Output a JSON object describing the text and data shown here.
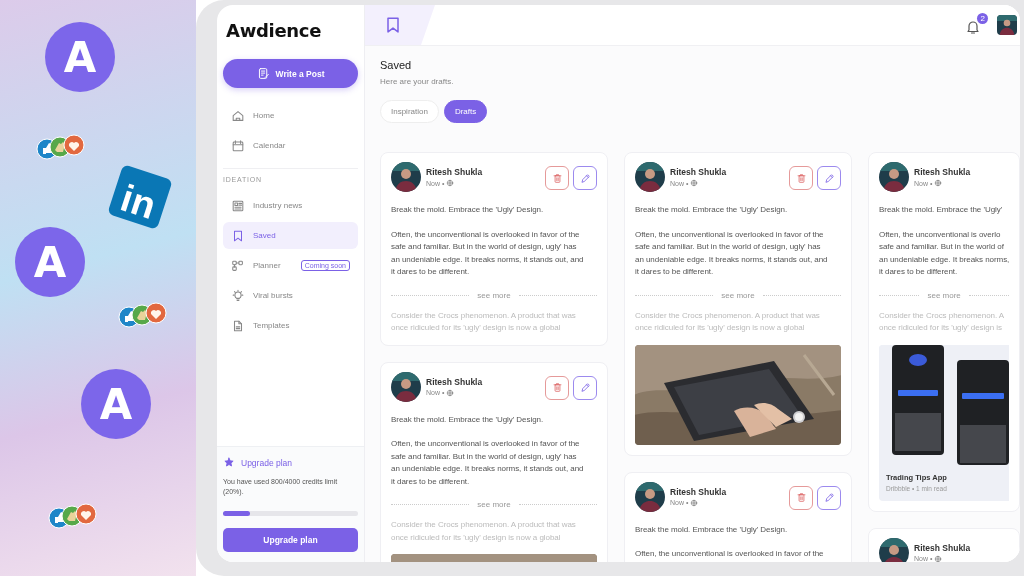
{
  "decorations": [
    {
      "kind": "logo",
      "text": "A"
    },
    {
      "kind": "reactions"
    },
    {
      "kind": "social",
      "text": "in"
    },
    {
      "kind": "logo",
      "text": "A"
    },
    {
      "kind": "reactions"
    },
    {
      "kind": "logo",
      "text": "A"
    },
    {
      "kind": "reactions"
    }
  ],
  "sidebar": {
    "logo": "Awdience",
    "write_button": "Write a Post",
    "nav": [
      {
        "label": "Home",
        "selected": false
      },
      {
        "label": "Calendar",
        "selected": false
      }
    ],
    "section": "IDEATION",
    "items": [
      {
        "label": "Industry news",
        "selected": false
      },
      {
        "label": "Saved",
        "selected": true
      },
      {
        "label": "Planner",
        "selected": false,
        "badge": "Coming soon"
      },
      {
        "label": "Viral bursts",
        "selected": false
      },
      {
        "label": "Templates",
        "selected": false
      }
    ],
    "upgrade": {
      "title": "Upgrade plan",
      "text": "You have used 800/4000 credits limit (20%).",
      "level": 0.2,
      "button": "Upgrade plan"
    }
  },
  "header": {
    "notifications": "2"
  },
  "page": {
    "title": "Saved",
    "subtitle": "Here are your drafts.",
    "tabs": [
      {
        "label": "Inspiration",
        "selected": false
      },
      {
        "label": "Drafts",
        "selected": true
      }
    ]
  },
  "columns": [
    [
      {
        "author": "Ritesh Shukla",
        "time": "Now •",
        "actions": true,
        "paragraphs": [
          [
            "Break the mold. Embrace the 'Ugly' Design."
          ],
          [
            "Often, the unconventional is overlooked in favor of the",
            "safe and familiar. But in the world of design, ugly' has",
            "an undeniable edge. It breaks norms, it stands out, and",
            "it dares to be different."
          ]
        ],
        "see_more": "see more",
        "excerpt": [
          "Consider the Crocs phenomenon. A product that was",
          "once ridiculed for its 'ugly' design is now a global"
        ]
      },
      {
        "author": "Ritesh Shukla",
        "time": "Now •",
        "actions": true,
        "paragraphs": [
          [
            "Break the mold. Embrace the 'Ugly' Design."
          ],
          [
            "Often, the unconventional is overlooked in favor of the",
            "safe and familiar. But in the world of design, ugly' has",
            "an undeniable edge. It breaks norms, it stands out, and",
            "it dares to be different."
          ]
        ],
        "see_more": "see more",
        "excerpt": [
          "Consider the Crocs phenomenon. A product that was",
          "once ridiculed for its 'ugly' design is now a global"
        ],
        "media": {
          "kind": "picture"
        }
      }
    ],
    [
      {
        "author": "Ritesh Shukla",
        "time": "Now •",
        "actions": true,
        "paragraphs": [
          [
            "Break the mold. Embrace the 'Ugly' Design."
          ],
          [
            "Often, the unconventional is overlooked in favor of the",
            "safe and familiar. But in the world of design, ugly' has",
            "an undeniable edge. It breaks norms, it stands out, and",
            "it dares to be different."
          ]
        ],
        "see_more": "see more",
        "excerpt": [
          "Consider the Crocs phenomenon. A product that was",
          "once ridiculed for its 'ugly' design is now a global"
        ],
        "media": {
          "kind": "picture"
        }
      },
      {
        "author": "Ritesh Shukla",
        "time": "Now •",
        "actions": true,
        "paragraphs": [
          [
            "Break the mold. Embrace the 'Ugly' Design."
          ],
          [
            "Often, the unconventional is overlooked in favor of the"
          ]
        ]
      }
    ],
    [
      {
        "author": "Ritesh Shukla",
        "time": "Now •",
        "actions": false,
        "paragraphs": [
          [
            "Break the mold. Embrace the 'Ugly'"
          ],
          [
            "Often, the unconventional is overlo",
            "safe and familiar. But in the world of",
            "an undeniable edge. It breaks norms,",
            "it dares to be different."
          ]
        ],
        "see_more": "see more",
        "excerpt": [
          "Consider the Crocs phenomenon. A",
          "once ridiculed for its 'ugly' design is"
        ],
        "media": {
          "kind": "link",
          "title": "Trading Tips App",
          "source": "Dribbble • 1 min read"
        }
      },
      {
        "author": "Ritesh Shukla",
        "time": "Now •",
        "actions": false
      }
    ]
  ]
}
